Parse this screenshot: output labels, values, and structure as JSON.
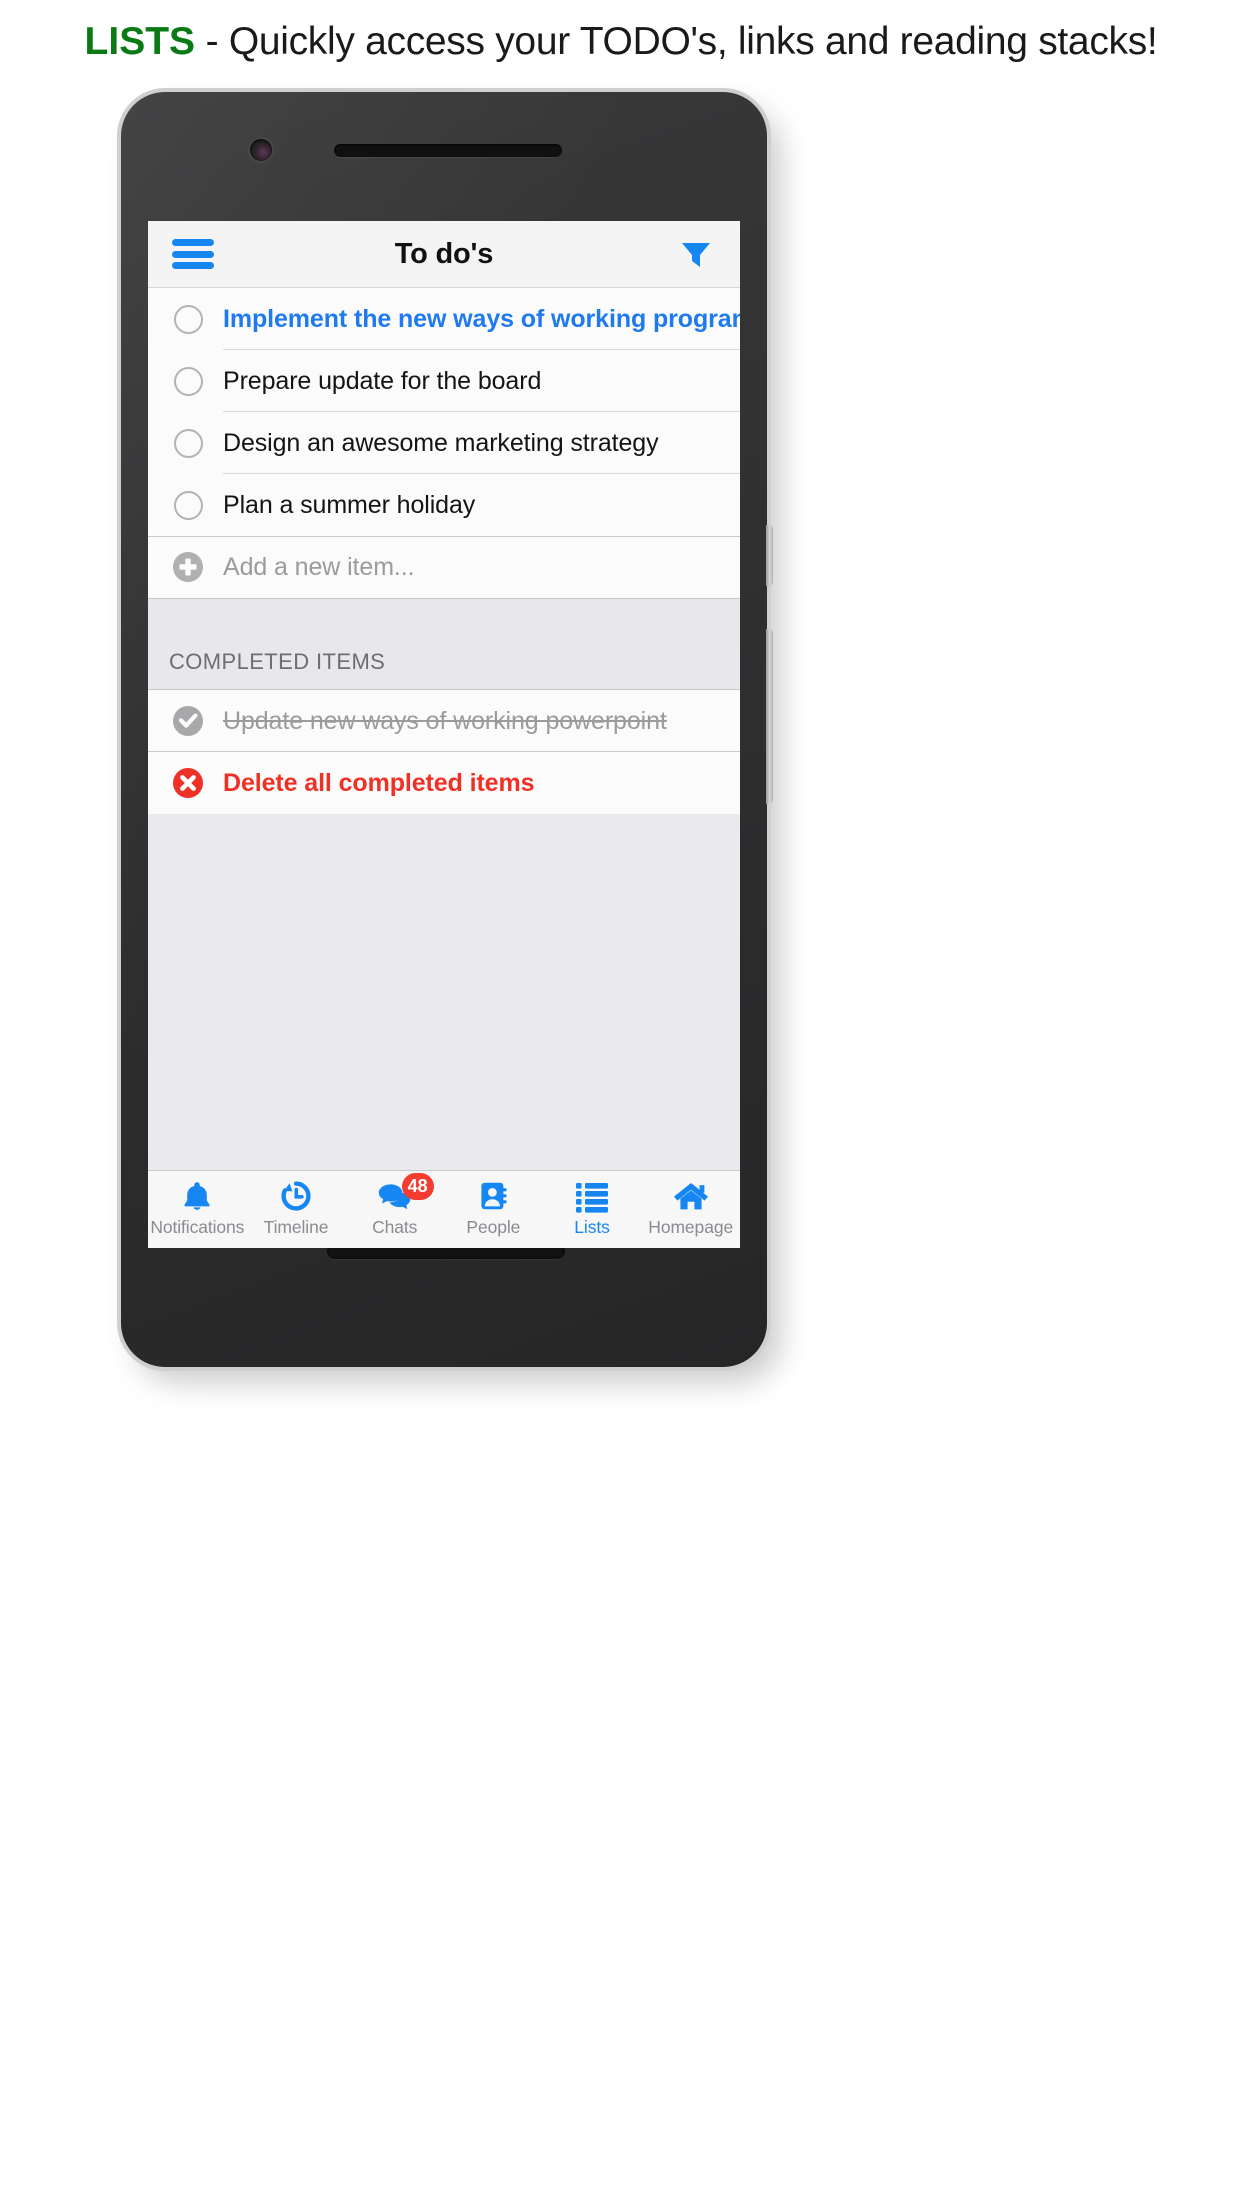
{
  "headline": {
    "keyword": "LISTS",
    "rest": " - Quickly access your TODO's, links and reading stacks!",
    "keyword_color": "#0a7a14"
  },
  "colors": {
    "accent_blue": "#1687f2",
    "link_blue": "#1f7af0",
    "danger_red": "#ef3024",
    "badge_red": "#f43c30",
    "muted_gray": "#9b9b9b",
    "screen_bg": "#eaeaee",
    "row_bg": "#fbfbfc",
    "section_bg": "#e8e8ec"
  },
  "app_header": {
    "menu_icon": "hamburger-icon",
    "title": "To do's",
    "filter_icon": "filter-funnel-icon"
  },
  "todo_list": {
    "items": [
      {
        "label": "Implement the new ways of working program",
        "state": "open",
        "style": "link"
      },
      {
        "label": "Prepare update for the board",
        "state": "open",
        "style": "normal"
      },
      {
        "label": "Design an awesome marketing strategy",
        "state": "open",
        "style": "normal"
      },
      {
        "label": "Plan a summer holiday",
        "state": "open",
        "style": "normal"
      }
    ],
    "add_row": {
      "label": "Add a new item...",
      "icon": "plus-circle-icon"
    },
    "completed_section": {
      "header": "COMPLETED ITEMS",
      "items": [
        {
          "label": "Update new ways of working powerpoint",
          "state": "done",
          "icon": "check-circle-icon"
        }
      ],
      "delete_row": {
        "label": "Delete all completed items",
        "icon": "x-circle-icon"
      }
    }
  },
  "tabbar": {
    "tabs": [
      {
        "label": "Notifications",
        "icon": "bell-icon",
        "active": false,
        "badge": null
      },
      {
        "label": "Timeline",
        "icon": "history-clock-icon",
        "active": false,
        "badge": null
      },
      {
        "label": "Chats",
        "icon": "chat-bubbles-icon",
        "active": false,
        "badge": "48"
      },
      {
        "label": "People",
        "icon": "contact-book-icon",
        "active": false,
        "badge": null
      },
      {
        "label": "Lists",
        "icon": "bulleted-list-icon",
        "active": true,
        "badge": null
      },
      {
        "label": "Homepage",
        "icon": "home-icon",
        "active": false,
        "badge": null
      }
    ]
  },
  "device": {
    "camera": "front-camera",
    "speaker_top": "earpiece-speaker",
    "speaker_bottom": "bottom-speaker",
    "buttons": [
      "power-button",
      "volume-rocker"
    ]
  }
}
